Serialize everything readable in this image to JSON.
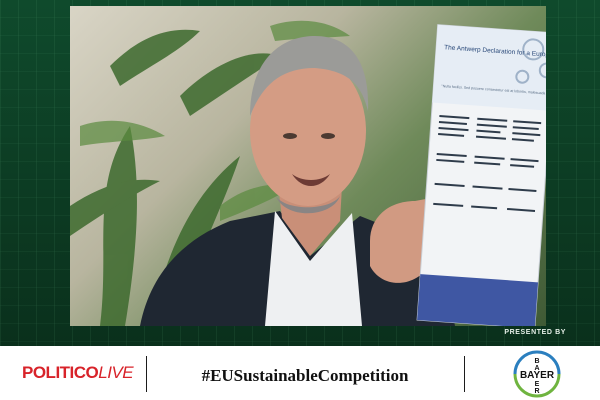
{
  "stream": {
    "presented_by": "PRESENTED BY",
    "document_title": "The Antwerp Declaration for a European Industrial Deal",
    "document_quote": "\"Nulla facilisi. Sed posuere consectetur est at lobortis, malesuada nisi\""
  },
  "footer": {
    "brand_primary": "POLITICO",
    "brand_secondary": "LIVE",
    "hashtag": "#EUSustainableCompetition",
    "sponsor": "BAYER",
    "colors": {
      "politico_red": "#d8232a",
      "bayer_blue": "#2b7fbf",
      "bayer_green": "#6fb43f",
      "background_green": "#0f4a2c"
    }
  }
}
